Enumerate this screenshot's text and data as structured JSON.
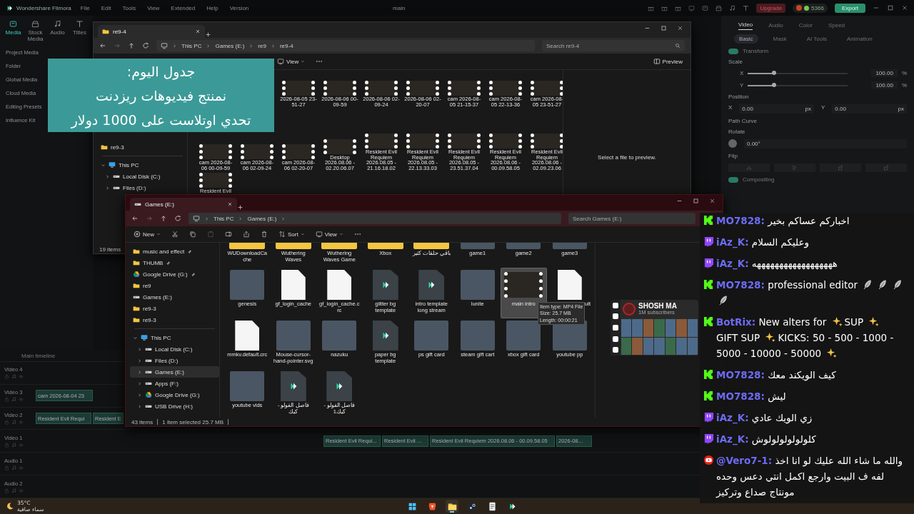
{
  "app": {
    "title": "Wondershare Filmora",
    "menu": [
      "File",
      "Edit",
      "Tools",
      "View",
      "Extended",
      "Help",
      "Version"
    ],
    "project": "main",
    "upgrade": "Upgrade",
    "credits": "5366",
    "export": "Export"
  },
  "media_tabs": [
    {
      "kind": "media",
      "label": "Media",
      "selected": true
    },
    {
      "kind": "stock",
      "label": "Stock Media",
      "selected": false
    },
    {
      "kind": "audio",
      "label": "Audio",
      "selected": false
    },
    {
      "kind": "titles",
      "label": "Titles",
      "selected": false
    }
  ],
  "left_nav": [
    "Project Media",
    "Folder",
    "Global Media",
    "Cloud Media",
    "Editing Presets",
    "Influence Kit"
  ],
  "properties": {
    "tabs": [
      {
        "label": "Video",
        "selected": true
      },
      {
        "label": "Audio",
        "selected": false
      },
      {
        "label": "Color",
        "selected": false
      },
      {
        "label": "Speed",
        "selected": false
      }
    ],
    "subtabs": [
      {
        "label": "Basic",
        "selected": true
      },
      {
        "label": "Mask",
        "selected": false
      },
      {
        "label": "AI Tools",
        "selected": false
      },
      {
        "label": "Animation",
        "selected": false
      }
    ],
    "transform": {
      "label": "Transform",
      "on": true
    },
    "scale": {
      "label": "Scale",
      "axes": [
        {
          "axis": "X",
          "level": 0.26,
          "value": "100.00",
          "unit": "%"
        },
        {
          "axis": "Y",
          "level": 0.26,
          "value": "100.00",
          "unit": "%"
        }
      ]
    },
    "position": {
      "label": "Position",
      "fields": [
        {
          "axis": "X",
          "value": "0.00",
          "unit": "px"
        },
        {
          "axis": "Y",
          "value": "0.00",
          "unit": "px"
        }
      ]
    },
    "path_curve": "Path Curve",
    "rotate": {
      "label": "Rotate",
      "value": "0.00°"
    },
    "flip": {
      "label": "Flip"
    },
    "compositing": {
      "label": "Compositing",
      "on": true
    }
  },
  "timeline": {
    "label": "Main timeline",
    "tracks": [
      {
        "label": "Video 4"
      },
      {
        "label": "Video 3",
        "clips": [
          "cam 2026-08-04 23"
        ]
      },
      {
        "label": "Video 2",
        "clips": [
          "Resident Evil Requi",
          "Resident E"
        ]
      },
      {
        "label": "Video 1",
        "clips": [
          "Resident Evil Requi...",
          "Resident Evil ...",
          "Resident Evil Requiem 2026.08.06 - 00.09.58.05",
          "2026-08..."
        ]
      },
      {
        "label": "Audio 1"
      },
      {
        "label": "Audio 2"
      }
    ]
  },
  "explorers": [
    {
      "tab": "re9-4",
      "path": [
        "This PC",
        "Games (E:)",
        "re9",
        "re9-4"
      ],
      "search": "Search re9-4",
      "toolbar": [
        {
          "kind": "view",
          "label": "View"
        },
        {
          "kind": "more"
        }
      ],
      "preview_toggle": "Preview",
      "preview_text": "Select a file to preview.",
      "sidebar": [
        [
          {
            "kind": "folder",
            "label": "re9-3",
            "selected": false
          }
        ],
        [
          {
            "kind": "pc",
            "label": "This PC",
            "selected": false,
            "expanded": true,
            "children": [
              {
                "kind": "drive",
                "label": "Local Disk (C:)",
                "selected": false,
                "expanded": false
              },
              {
                "kind": "drive",
                "label": "Files (D:)",
                "selected": false,
                "expanded": false
              }
            ]
          }
        ]
      ],
      "files": [
        {
          "name": "2026-08-05 23-51-27",
          "kind": "video",
          "selected": false
        },
        {
          "name": "2026-08-06 00-09-59",
          "kind": "video",
          "selected": false
        },
        {
          "name": "2026-08-06 02-09-24",
          "kind": "video",
          "selected": false
        },
        {
          "name": "2026-08-06 02-20-07",
          "kind": "video",
          "selected": false
        },
        {
          "name": "cam 2026-08-05 21-15-37",
          "kind": "video",
          "selected": false
        },
        {
          "name": "cam 2026-08-05 22-13-36",
          "kind": "video",
          "selected": false
        },
        {
          "name": "cam 2026-08-05 23-51-27",
          "kind": "video",
          "selected": false
        },
        {
          "name": "cam 2026-08-06 00-09-59",
          "kind": "video",
          "selected": false
        },
        {
          "name": "cam 2026-08-06 02-09-24",
          "kind": "video",
          "selected": false
        },
        {
          "name": "cam 2026-08-06 02-20-07",
          "kind": "video",
          "selected": false
        },
        {
          "name": "Desktop 2026.08.06 - 02.20.06.07",
          "kind": "video",
          "selected": false
        },
        {
          "name": "Resident Evil Requiem 2026.08.05 - 21.16.18.02",
          "kind": "video",
          "selected": false
        },
        {
          "name": "Resident Evil Requiem 2026.08.05 - 22.13.33.03",
          "kind": "video",
          "selected": false
        },
        {
          "name": "Resident Evil Requiem 2026.08.05 - 23.51.37.04",
          "kind": "video",
          "selected": false
        },
        {
          "name": "Resident Evil Requiem 2026.08.06 - 00.09.58.05",
          "kind": "video",
          "selected": false
        },
        {
          "name": "Resident Evil Requiem 2026.08.06 - 02.09.23.06",
          "kind": "video",
          "selected": false
        },
        {
          "name": "Resident Evil",
          "kind": "video",
          "selected": false
        }
      ],
      "status": [
        "19 items"
      ]
    },
    {
      "tab": "Games (E:)",
      "path": [
        "This PC",
        "Games (E:)"
      ],
      "search": "Search Games (E:)",
      "toolbar": [
        {
          "kind": "new",
          "label": "New"
        },
        {
          "kind": "cut"
        },
        {
          "kind": "copy"
        },
        {
          "kind": "paste",
          "disabled": true
        },
        {
          "kind": "rename"
        },
        {
          "kind": "share"
        },
        {
          "kind": "delete"
        },
        {
          "kind": "sort",
          "label": "Sort"
        },
        {
          "kind": "view",
          "label": "View"
        },
        {
          "kind": "more"
        }
      ],
      "sidebar": [
        [
          {
            "kind": "folder",
            "label": "music and effect",
            "selected": false,
            "pinned": true
          },
          {
            "kind": "folder",
            "label": "THUMB",
            "selected": false,
            "pinned": true
          },
          {
            "kind": "gdrive",
            "label": "Google Drive (G:)",
            "selected": false,
            "pinned": true
          },
          {
            "kind": "folder",
            "label": "re9",
            "selected": false,
            "pinned": false
          },
          {
            "kind": "drive",
            "label": "Games (E:)",
            "selected": false,
            "pinned": false
          },
          {
            "kind": "folder",
            "label": "re9-3",
            "selected": false,
            "pinned": false
          },
          {
            "kind": "folder",
            "label": "re9-3",
            "selected": false,
            "pinned": false
          }
        ],
        [
          {
            "kind": "pc",
            "label": "This PC",
            "selected": false,
            "expanded": true,
            "children": [
              {
                "kind": "drive",
                "label": "Local Disk (C:)",
                "selected": false,
                "expanded": false
              },
              {
                "kind": "drive",
                "label": "Files (D:)",
                "selected": false,
                "expanded": false
              },
              {
                "kind": "drive",
                "label": "Games (E:)",
                "selected": true,
                "expanded": false
              },
              {
                "kind": "drive",
                "label": "Apps (F:)",
                "selected": false,
                "expanded": false
              },
              {
                "kind": "gdrive",
                "label": "Google Drive (G:)",
                "selected": false,
                "expanded": false
              },
              {
                "kind": "drive",
                "label": "USB Drive (H:)",
                "selected": false,
                "expanded": false
              }
            ]
          }
        ]
      ],
      "files": [
        {
          "name": "WUDownloadCache",
          "kind": "folder",
          "selected": false
        },
        {
          "name": "Wuthering Waves",
          "kind": "folder",
          "selected": false
        },
        {
          "name": "Wuthering Waves Game",
          "kind": "folder",
          "selected": false
        },
        {
          "name": "Xbox",
          "kind": "folder",
          "selected": false
        },
        {
          "name": "باقي حلقات كثير",
          "kind": "folder",
          "selected": false
        },
        {
          "name": "game1",
          "kind": "image",
          "selected": false
        },
        {
          "name": "game2",
          "kind": "image",
          "selected": false
        },
        {
          "name": "game3",
          "kind": "image",
          "selected": false
        },
        {
          "name": "genesis",
          "kind": "image",
          "selected": false
        },
        {
          "name": "gf_login_cache",
          "kind": "document",
          "selected": false
        },
        {
          "name": "gf_login_cache.crc",
          "kind": "document",
          "selected": false
        },
        {
          "name": "glitter bg template",
          "kind": "project",
          "selected": false
        },
        {
          "name": "intro template long stream",
          "kind": "project",
          "selected": false
        },
        {
          "name": "lunite",
          "kind": "image",
          "selected": false
        },
        {
          "name": "main intro",
          "kind": "video",
          "selected": true
        },
        {
          "name": "ult",
          "kind": "document",
          "selected": false,
          "clipped": true
        },
        {
          "name": "mmkv.default.crc",
          "kind": "document",
          "selected": false
        },
        {
          "name": "Mouse-cursor-hand-pointer.svg",
          "kind": "image",
          "selected": false
        },
        {
          "name": "nazuku",
          "kind": "image",
          "selected": false
        },
        {
          "name": "paper bg template",
          "kind": "project",
          "selected": false
        },
        {
          "name": "ps gift card",
          "kind": "image",
          "selected": false
        },
        {
          "name": "steam gift cart",
          "kind": "image",
          "selected": false
        },
        {
          "name": "xbox gift card",
          "kind": "image",
          "selected": false
        },
        {
          "name": "youtube pp",
          "kind": "image",
          "selected": false
        },
        {
          "name": "youtube vids",
          "kind": "image",
          "selected": false
        },
        {
          "name": "فاصل الفولو - كيك",
          "kind": "project",
          "selected": false
        },
        {
          "name": "فاصل الفولو - كيك1",
          "kind": "project",
          "selected": false
        }
      ],
      "tooltip": [
        "Item type: MP4 File",
        "Size: 25.7 MB",
        "Length: 00:00:21"
      ],
      "status": [
        "43 items",
        "1 item selected  25.7 MB"
      ]
    }
  ],
  "banner": [
    "جدول اليوم:",
    "نمنتج فيديوهات ريزدنت",
    "تحدي اوتلاست على 1000 دولار"
  ],
  "stream_card": {
    "name": "SHOSH MA",
    "subtitle": "1M subscribers"
  },
  "chat": [
    {
      "kind": "kick",
      "user": "MO7828:",
      "parts": [
        {
          "kind": "text",
          "text": "اخباركم عساكم بخير"
        }
      ]
    },
    {
      "kind": "twitch",
      "user": "iAz_K:",
      "parts": [
        {
          "kind": "text",
          "text": "وعليكم السلام"
        }
      ]
    },
    {
      "kind": "twitch",
      "user": "iAz_K:",
      "parts": [
        {
          "kind": "text",
          "text": "ههههههههههههههههههه"
        }
      ]
    },
    {
      "kind": "kick",
      "user": "MO7828:",
      "parts": [
        {
          "kind": "text",
          "text": "professional editor"
        },
        {
          "kind": "feather"
        },
        {
          "kind": "feather"
        },
        {
          "kind": "feather"
        },
        {
          "kind": "feather"
        }
      ]
    },
    {
      "kind": "kick",
      "user": "BotRix:",
      "parts": [
        {
          "kind": "text",
          "text": "New alters for"
        },
        {
          "kind": "sparkles"
        },
        {
          "kind": "text",
          "text": "SUP"
        },
        {
          "kind": "sparkles"
        },
        {
          "kind": "text",
          "text": "GIFT SUP"
        },
        {
          "kind": "sparkles"
        },
        {
          "kind": "text",
          "text": "KICKS: 50 - 500 - 1000 -"
        },
        {
          "kind": "text",
          "text": "5000 - 10000 - 50000"
        },
        {
          "kind": "sparkles"
        }
      ]
    },
    {
      "kind": "kick",
      "user": "MO7828:",
      "parts": [
        {
          "kind": "text",
          "text": "كيف الويكند معك"
        }
      ]
    },
    {
      "kind": "kick",
      "user": "MO7828:",
      "parts": [
        {
          "kind": "text",
          "text": "ليش"
        }
      ]
    },
    {
      "kind": "twitch",
      "user": "iAz_K:",
      "parts": [
        {
          "kind": "text",
          "text": "زي الويك عادي"
        }
      ]
    },
    {
      "kind": "twitch",
      "user": "iAz_K:",
      "parts": [
        {
          "kind": "text",
          "text": "كلولولولولولوش"
        }
      ]
    },
    {
      "kind": "youtube",
      "user": "@Vero7-1:",
      "parts": [
        {
          "kind": "text",
          "text": "والله ما شاء الله عليك لو انا اخذ لفه ف البيت وارجع اكمل انتي دعس وحده مونتاج صداع وتركيز"
        }
      ]
    }
  ],
  "taskbar": {
    "temperature": "35°C",
    "weather": "سماء صافية",
    "apps": [
      {
        "kind": "windows",
        "active": false
      },
      {
        "kind": "browser",
        "active": false
      },
      {
        "kind": "explorer",
        "active": true
      },
      {
        "kind": "steam",
        "active": false
      },
      {
        "kind": "notes",
        "active": false
      },
      {
        "kind": "filmora",
        "active": false
      }
    ]
  }
}
